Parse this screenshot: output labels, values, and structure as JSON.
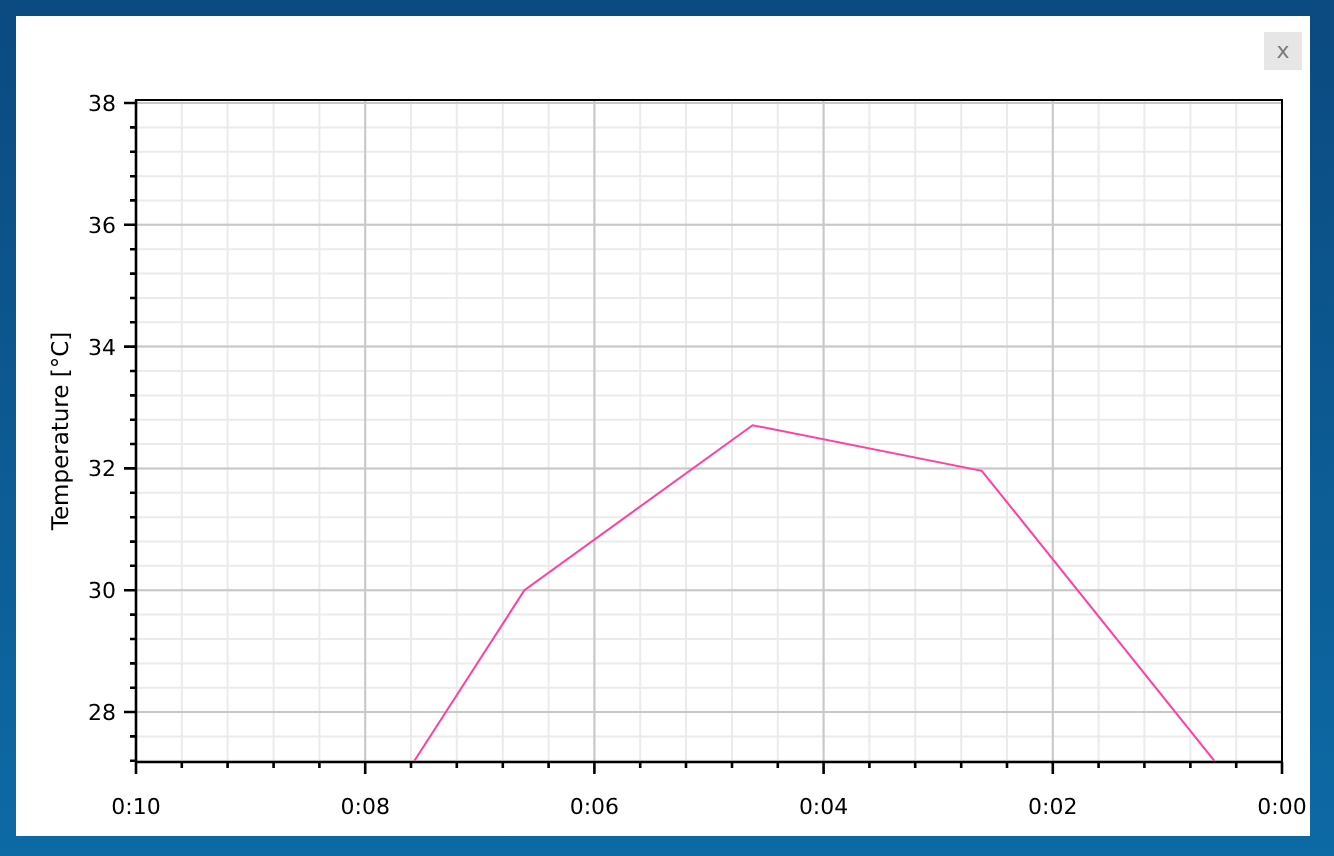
{
  "window": {
    "close_label": "x"
  },
  "chart": {
    "chart_data": {
      "type": "line",
      "ylabel": "Temperature [°C]",
      "x": [
        7.57,
        6.61,
        4.62,
        2.62,
        0.59
      ],
      "series": [
        {
          "color": "#ff3fa4",
          "values": [
            27.2,
            30.0,
            32.71,
            31.96,
            27.2
          ]
        }
      ],
      "grid": true,
      "xlim": [
        10,
        0
      ],
      "ylim": [
        27.18,
        38.05
      ],
      "xticks": [
        {
          "value": 10,
          "label": "0:10"
        },
        {
          "value": 8,
          "label": "0:08"
        },
        {
          "value": 6,
          "label": "0:06"
        },
        {
          "value": 4,
          "label": "0:04"
        },
        {
          "value": 2,
          "label": "0:02"
        },
        {
          "value": 0,
          "label": "0:00"
        }
      ],
      "yticks": [
        28,
        30,
        32,
        34,
        36,
        38
      ]
    }
  }
}
